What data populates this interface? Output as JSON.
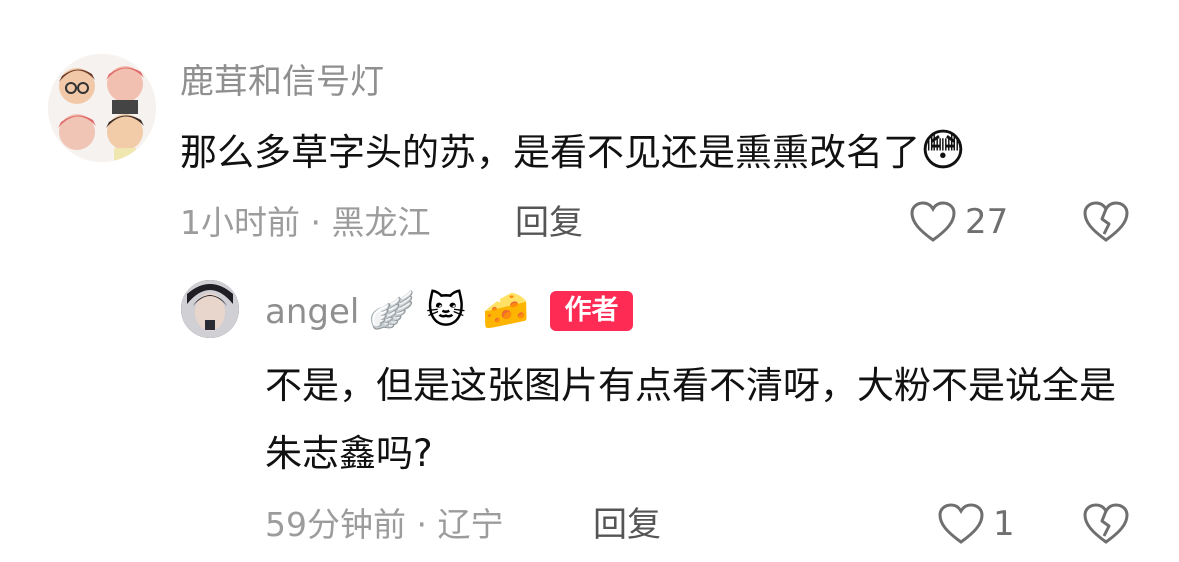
{
  "comments": [
    {
      "username": "鹿茸和信号灯",
      "text": "那么多草字头的苏，是看不见还是熏熏改名了",
      "emoji": "😳",
      "time_location": "1小时前 · 黑龙江",
      "reply_label": "回复",
      "likes": "27",
      "avatar_icon": "cartoon-avatar-grid"
    },
    {
      "username": "angel",
      "name_badges": [
        "🪽",
        "🐱",
        "🧀"
      ],
      "author_label": "作者",
      "text": "不是，但是这张图片有点看不清呀，大粉不是说全是朱志鑫吗?",
      "time_location": "59分钟前 · 辽宁",
      "reply_label": "回复",
      "likes": "1",
      "avatar_icon": "profile-photo"
    }
  ],
  "colors": {
    "author_badge": "#fe2c55",
    "username": "#8f8f8f",
    "body_text": "#111111",
    "meta_text": "#9c9c9c"
  }
}
